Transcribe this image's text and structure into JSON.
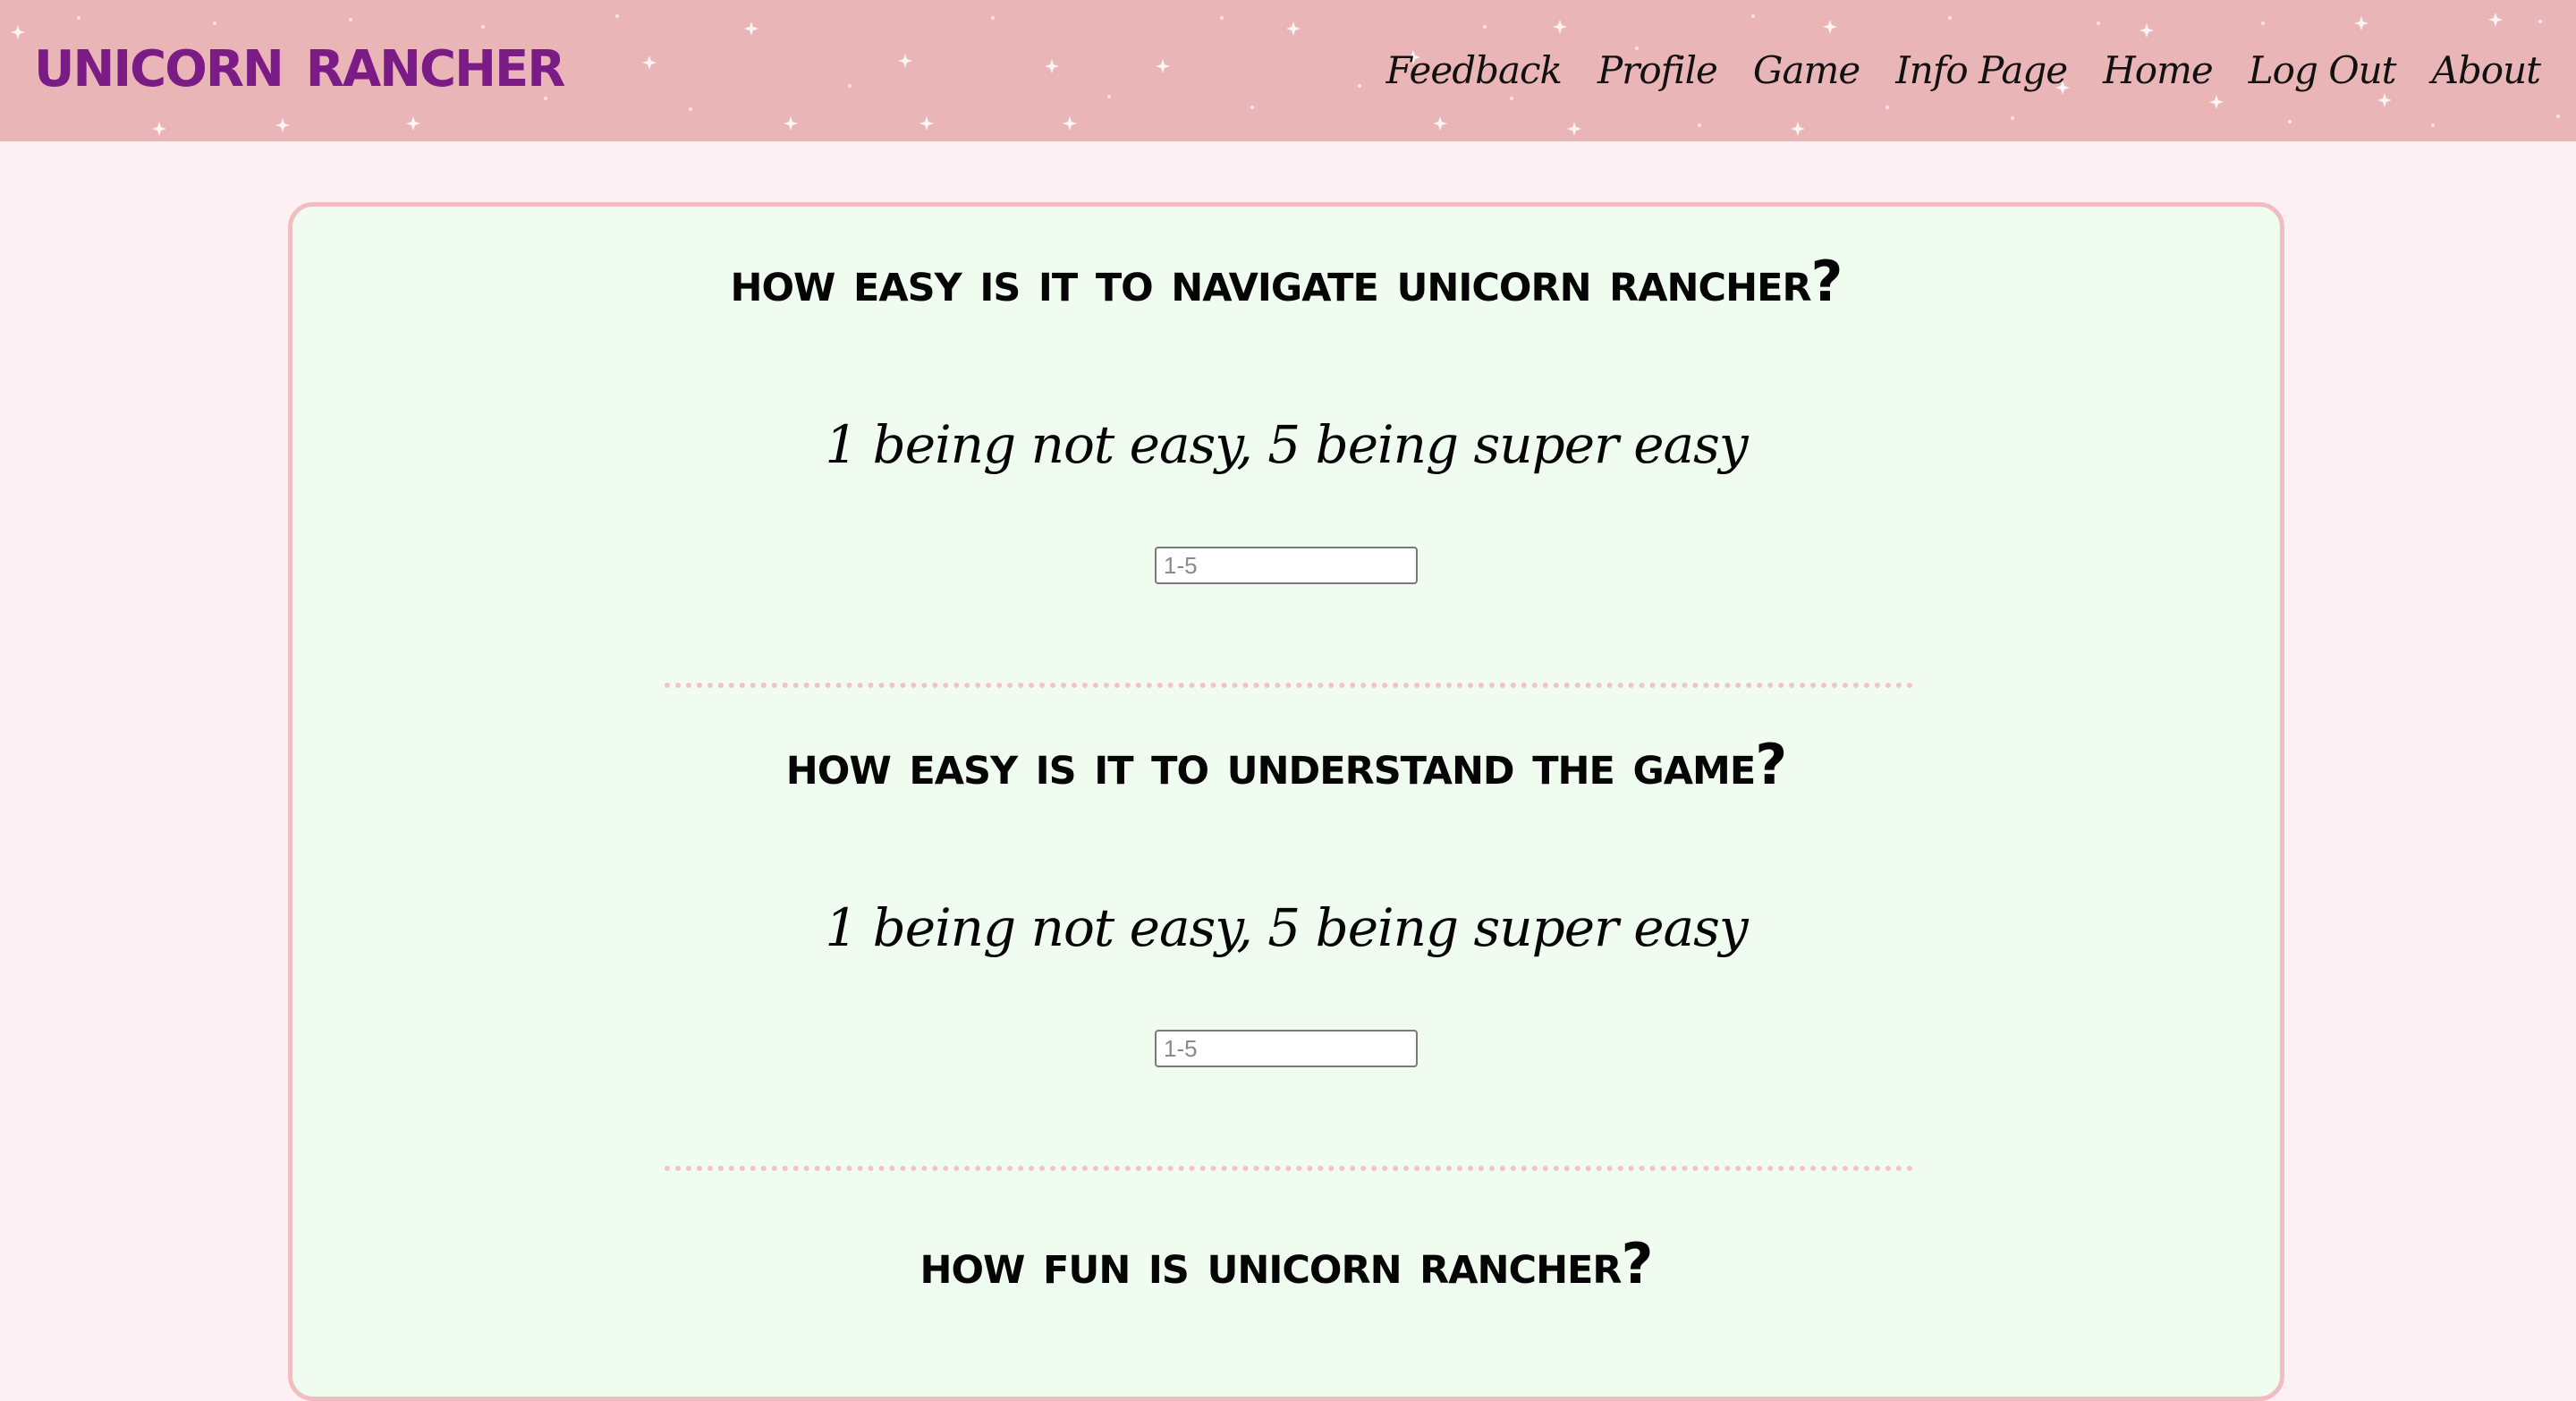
{
  "header": {
    "logo": "Unicorn Rancher",
    "nav": [
      "Feedback",
      "Profile",
      "Game",
      "Info Page",
      "Home",
      "Log Out",
      "About"
    ]
  },
  "questions": [
    {
      "title": "How easy is it to navigate Unicorn Rancher?",
      "subtitle": "1 being not easy, 5 being super easy",
      "placeholder": "1-5"
    },
    {
      "title": "How easy is it to understand the game?",
      "subtitle": "1 being not easy, 5 being super easy",
      "placeholder": "1-5"
    },
    {
      "title": "How fun is Unicorn Rancher?"
    }
  ],
  "colors": {
    "header_bg": "#eab5b7",
    "page_bg": "#fcf0f4",
    "card_bg": "#f0fcf0",
    "card_border": "#f1bcc2",
    "logo": "#7a1b86"
  }
}
